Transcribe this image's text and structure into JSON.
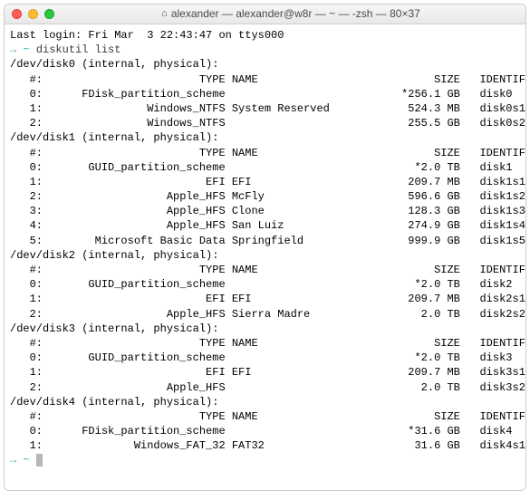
{
  "window": {
    "title": "alexander — alexander@w8r — ~ — -zsh — 80×37"
  },
  "motd": "Last login: Fri Mar  3 22:43:47 on ttys000",
  "prompt_arrow": "→",
  "prompt_tilde": "~",
  "command": "diskutil list",
  "headers": {
    "num": "#:",
    "type": "TYPE",
    "name": "NAME",
    "size": "SIZE",
    "id": "IDENTIFIER"
  },
  "disks": [
    {
      "header": "/dev/disk0 (internal, physical):",
      "rows": [
        {
          "n": "0:",
          "type": "FDisk_partition_scheme",
          "name": "",
          "size": "*256.1 GB",
          "id": "disk0"
        },
        {
          "n": "1:",
          "type": "Windows_NTFS",
          "name": "System Reserved",
          "size": "524.3 MB",
          "id": "disk0s1"
        },
        {
          "n": "2:",
          "type": "Windows_NTFS",
          "name": "",
          "size": "255.5 GB",
          "id": "disk0s2"
        }
      ]
    },
    {
      "header": "/dev/disk1 (internal, physical):",
      "rows": [
        {
          "n": "0:",
          "type": "GUID_partition_scheme",
          "name": "",
          "size": "*2.0 TB",
          "id": "disk1"
        },
        {
          "n": "1:",
          "type": "EFI",
          "name": "EFI",
          "size": "209.7 MB",
          "id": "disk1s1"
        },
        {
          "n": "2:",
          "type": "Apple_HFS",
          "name": "McFly",
          "size": "596.6 GB",
          "id": "disk1s2"
        },
        {
          "n": "3:",
          "type": "Apple_HFS",
          "name": "Clone",
          "size": "128.3 GB",
          "id": "disk1s3"
        },
        {
          "n": "4:",
          "type": "Apple_HFS",
          "name": "San Luiz",
          "size": "274.9 GB",
          "id": "disk1s4"
        },
        {
          "n": "5:",
          "type": "Microsoft Basic Data",
          "name": "Springfield",
          "size": "999.9 GB",
          "id": "disk1s5"
        }
      ]
    },
    {
      "header": "/dev/disk2 (internal, physical):",
      "rows": [
        {
          "n": "0:",
          "type": "GUID_partition_scheme",
          "name": "",
          "size": "*2.0 TB",
          "id": "disk2"
        },
        {
          "n": "1:",
          "type": "EFI",
          "name": "EFI",
          "size": "209.7 MB",
          "id": "disk2s1"
        },
        {
          "n": "2:",
          "type": "Apple_HFS",
          "name": "Sierra Madre",
          "size": "2.0 TB",
          "id": "disk2s2"
        }
      ]
    },
    {
      "header": "/dev/disk3 (internal, physical):",
      "rows": [
        {
          "n": "0:",
          "type": "GUID_partition_scheme",
          "name": "",
          "size": "*2.0 TB",
          "id": "disk3"
        },
        {
          "n": "1:",
          "type": "EFI",
          "name": "EFI",
          "size": "209.7 MB",
          "id": "disk3s1"
        },
        {
          "n": "2:",
          "type": "Apple_HFS",
          "name": "",
          "size": "2.0 TB",
          "id": "disk3s2"
        }
      ]
    },
    {
      "header": "/dev/disk4 (internal, physical):",
      "rows": [
        {
          "n": "0:",
          "type": "FDisk_partition_scheme",
          "name": "",
          "size": "*31.6 GB",
          "id": "disk4"
        },
        {
          "n": "1:",
          "type": "Windows_FAT_32",
          "name": "FAT32",
          "size": "31.6 GB",
          "id": "disk4s1"
        }
      ]
    }
  ]
}
